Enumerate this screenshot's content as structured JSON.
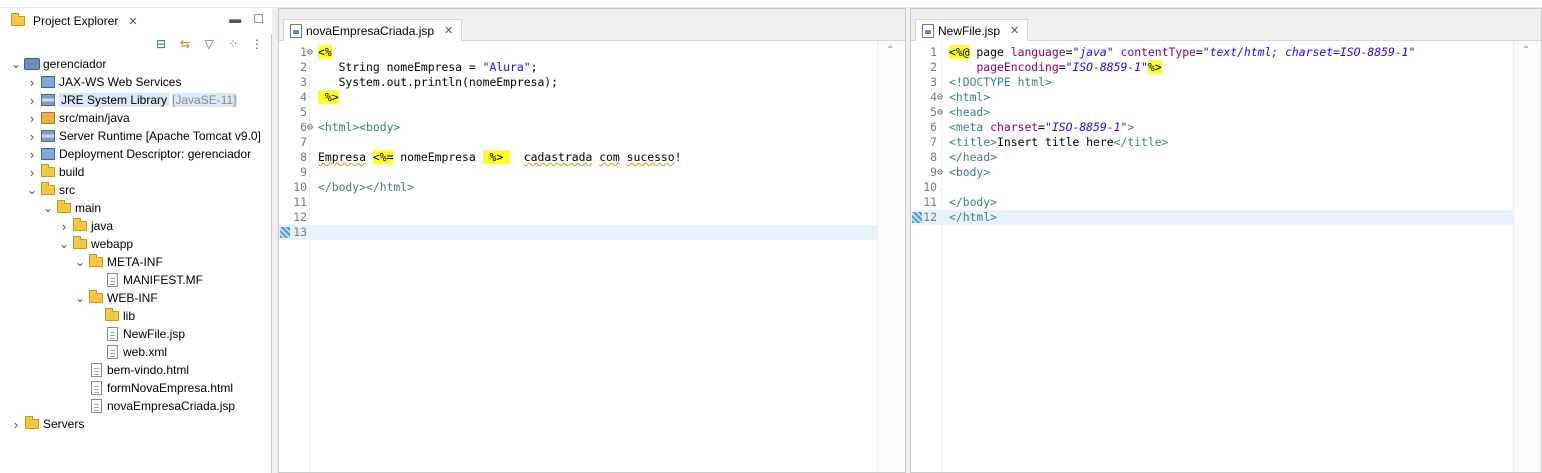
{
  "explorer": {
    "tab_label": "Project Explorer",
    "tree": [
      {
        "label": "gerenciador",
        "indent": 0,
        "expanded": true,
        "icon": "project-icon"
      },
      {
        "label": "JAX-WS Web Services",
        "indent": 1,
        "expanded": false,
        "icon": "webservice-icon"
      },
      {
        "label": "JRE System Library",
        "decoration": "[JavaSE-11]",
        "indent": 1,
        "expanded": false,
        "icon": "library-icon",
        "selected": true
      },
      {
        "label": "src/main/java",
        "indent": 1,
        "expanded": false,
        "icon": "source-folder-icon"
      },
      {
        "label": "Server Runtime [Apache Tomcat v9.0]",
        "indent": 1,
        "expanded": false,
        "icon": "library-icon"
      },
      {
        "label": "Deployment Descriptor: gerenciador",
        "indent": 1,
        "expanded": false,
        "icon": "descriptor-icon"
      },
      {
        "label": "build",
        "indent": 1,
        "expanded": false,
        "icon": "folder-icon"
      },
      {
        "label": "src",
        "indent": 1,
        "expanded": true,
        "icon": "folder-icon"
      },
      {
        "label": "main",
        "indent": 2,
        "expanded": true,
        "icon": "folder-icon"
      },
      {
        "label": "java",
        "indent": 3,
        "expanded": false,
        "icon": "folder-icon"
      },
      {
        "label": "webapp",
        "indent": 3,
        "expanded": true,
        "icon": "folder-icon"
      },
      {
        "label": "META-INF",
        "indent": 4,
        "expanded": true,
        "icon": "folder-icon"
      },
      {
        "label": "MANIFEST.MF",
        "indent": 5,
        "leaf": true,
        "icon": "file-icon"
      },
      {
        "label": "WEB-INF",
        "indent": 4,
        "expanded": true,
        "icon": "folder-icon"
      },
      {
        "label": "lib",
        "indent": 5,
        "leaf": true,
        "icon": "folder-icon"
      },
      {
        "label": "NewFile.jsp",
        "indent": 5,
        "leaf": true,
        "icon": "file-icon"
      },
      {
        "label": "web.xml",
        "indent": 5,
        "leaf": true,
        "icon": "xml-file-icon"
      },
      {
        "label": "bem-vindo.html",
        "indent": 4,
        "leaf": true,
        "icon": "file-icon"
      },
      {
        "label": "formNovaEmpresa.html",
        "indent": 4,
        "leaf": true,
        "icon": "file-icon"
      },
      {
        "label": "novaEmpresaCriada.jsp",
        "indent": 4,
        "leaf": true,
        "icon": "file-icon"
      },
      {
        "label": "Servers",
        "indent": 0,
        "expanded": false,
        "icon": "folder-icon"
      }
    ]
  },
  "editor1": {
    "tab_label": "novaEmpresaCriada.jsp",
    "lines": [
      {
        "n": "1",
        "fold": true,
        "segs": [
          {
            "t": "<%",
            "c": "hl"
          }
        ]
      },
      {
        "n": "2",
        "segs": [
          {
            "t": "   String nomeEmpresa = ",
            "c": "plain"
          },
          {
            "t": "\"Alura\"",
            "c": "str"
          },
          {
            "t": ";",
            "c": "plain"
          }
        ]
      },
      {
        "n": "3",
        "segs": [
          {
            "t": "   System.out.println(nomeEmpresa);",
            "c": "plain"
          }
        ]
      },
      {
        "n": "4",
        "segs": [
          {
            "t": " %>",
            "c": "hl"
          }
        ]
      },
      {
        "n": "5",
        "segs": []
      },
      {
        "n": "6",
        "fold": true,
        "segs": [
          {
            "t": "<html><body>",
            "c": "tag"
          }
        ]
      },
      {
        "n": "7",
        "segs": []
      },
      {
        "n": "8",
        "segs": [
          {
            "t": "Empresa",
            "c": "squig"
          },
          {
            "t": " ",
            "c": "plain"
          },
          {
            "t": "<%=",
            "c": "hl"
          },
          {
            "t": " nomeEmpresa ",
            "c": "plain"
          },
          {
            "t": " %> ",
            "c": "hl"
          },
          {
            "t": "  ",
            "c": "plain"
          },
          {
            "t": "cadastrada",
            "c": "squig"
          },
          {
            "t": " ",
            "c": "plain"
          },
          {
            "t": "com",
            "c": "squig"
          },
          {
            "t": " ",
            "c": "plain"
          },
          {
            "t": "sucesso",
            "c": "squig"
          },
          {
            "t": "!",
            "c": "plain"
          }
        ]
      },
      {
        "n": "9",
        "segs": []
      },
      {
        "n": "10",
        "segs": [
          {
            "t": "</body></html>",
            "c": "tag"
          }
        ]
      },
      {
        "n": "11",
        "segs": []
      },
      {
        "n": "12",
        "segs": []
      },
      {
        "n": "13",
        "segs": [],
        "current": true,
        "marker": true
      }
    ]
  },
  "editor2": {
    "tab_label": "NewFile.jsp",
    "lines": [
      {
        "n": "1",
        "segs": [
          {
            "t": "<%@",
            "c": "hl"
          },
          {
            "t": " page ",
            "c": "kwplain"
          },
          {
            "t": "language",
            "c": "attr"
          },
          {
            "t": "=",
            "c": "plain"
          },
          {
            "t": "\"java\"",
            "c": "aval"
          },
          {
            "t": " ",
            "c": "plain"
          },
          {
            "t": "contentType",
            "c": "attr"
          },
          {
            "t": "=",
            "c": "plain"
          },
          {
            "t": "\"text/html; charset=ISO-8859-1\"",
            "c": "aval"
          }
        ]
      },
      {
        "n": "2",
        "segs": [
          {
            "t": "    ",
            "c": "plain"
          },
          {
            "t": "pageEncoding",
            "c": "attr"
          },
          {
            "t": "=",
            "c": "plain"
          },
          {
            "t": "\"ISO-8859-1\"",
            "c": "aval"
          },
          {
            "t": "%>",
            "c": "hl"
          }
        ]
      },
      {
        "n": "3",
        "segs": [
          {
            "t": "<!DOCTYPE html>",
            "c": "tag"
          }
        ]
      },
      {
        "n": "4",
        "fold": true,
        "segs": [
          {
            "t": "<html>",
            "c": "tag"
          }
        ]
      },
      {
        "n": "5",
        "fold": true,
        "segs": [
          {
            "t": "<head>",
            "c": "tag"
          }
        ]
      },
      {
        "n": "6",
        "segs": [
          {
            "t": "<meta ",
            "c": "tag"
          },
          {
            "t": "charset",
            "c": "attr"
          },
          {
            "t": "=",
            "c": "plain"
          },
          {
            "t": "\"ISO-8859-1\"",
            "c": "aval"
          },
          {
            "t": ">",
            "c": "tag"
          }
        ]
      },
      {
        "n": "7",
        "segs": [
          {
            "t": "<title>",
            "c": "tag"
          },
          {
            "t": "Insert title here",
            "c": "plain"
          },
          {
            "t": "</title>",
            "c": "tag"
          }
        ]
      },
      {
        "n": "8",
        "segs": [
          {
            "t": "</head>",
            "c": "tag"
          }
        ]
      },
      {
        "n": "9",
        "fold": true,
        "segs": [
          {
            "t": "<body>",
            "c": "tag"
          }
        ]
      },
      {
        "n": "10",
        "segs": []
      },
      {
        "n": "11",
        "segs": [
          {
            "t": "</body>",
            "c": "tag"
          }
        ]
      },
      {
        "n": "12",
        "segs": [
          {
            "t": "</html>",
            "c": "tag"
          }
        ],
        "current": true,
        "marker": true
      }
    ]
  },
  "colors": {
    "highlight": "#ffff2e",
    "tag": "#3f7f7f",
    "attribute": "#7f007f",
    "string": "#2a00ff",
    "current_line": "#e8f2fe"
  }
}
